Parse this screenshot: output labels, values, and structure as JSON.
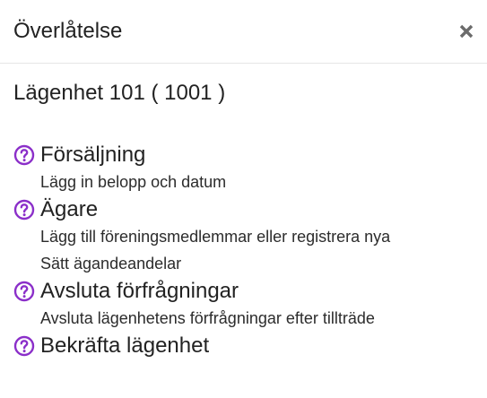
{
  "dialog": {
    "title": "Överlåtelse",
    "close_icon": "close-icon"
  },
  "apartment": {
    "label": "Lägenhet 101 ( 1001 )"
  },
  "colors": {
    "help_icon": "#8b2fc9",
    "text": "#222222",
    "divider": "#e6e6e6",
    "close_icon": "#6b6b6b"
  },
  "steps": [
    {
      "title": "Försäljning",
      "icon": "help-circle-icon",
      "descriptions": [
        "Lägg in belopp och datum"
      ]
    },
    {
      "title": "Ägare",
      "icon": "help-circle-icon",
      "descriptions": [
        "Lägg till föreningsmedlemmar eller registrera nya",
        "Sätt ägandeandelar"
      ]
    },
    {
      "title": "Avsluta förfrågningar",
      "icon": "help-circle-icon",
      "descriptions": [
        "Avsluta lägenhetens förfrågningar efter tillträde"
      ]
    },
    {
      "title": "Bekräfta lägenhet",
      "icon": "help-circle-icon",
      "descriptions": []
    }
  ]
}
